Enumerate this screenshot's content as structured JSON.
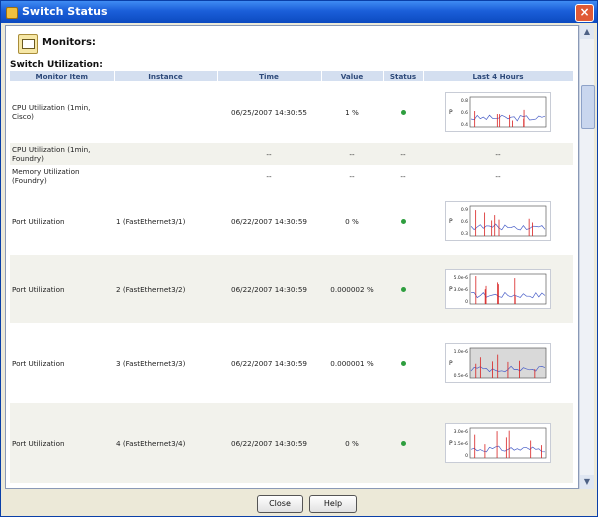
{
  "window": {
    "title": "Switch Status",
    "close_glyph": "×"
  },
  "monitors_label": "Monitors:",
  "section_title": "Switch Utilization:",
  "columns": [
    "Monitor Item",
    "Instance",
    "Time",
    "Value",
    "Status",
    "Last 4 Hours"
  ],
  "rows": [
    {
      "item": "CPU Utilization (1min, Cisco)",
      "instance": "",
      "time": "06/25/2007 14:30:55",
      "value": "1 %",
      "status": "ok",
      "chart": 0
    },
    {
      "item": "CPU Utilization (1min, Foundry)",
      "instance": "",
      "time": "--",
      "value": "--",
      "status_text": "--",
      "last4": "--"
    },
    {
      "item": "Memory Utilization (Foundry)",
      "instance": "",
      "time": "--",
      "value": "--",
      "status_text": "--",
      "last4": "--"
    },
    {
      "item": "Port Utilization",
      "instance": "1 (FastEthernet3/1)",
      "time": "06/22/2007 14:30:59",
      "value": "0 %",
      "status": "ok",
      "chart": 1
    },
    {
      "item": "Port Utilization",
      "instance": "2 (FastEthernet3/2)",
      "time": "06/22/2007 14:30:59",
      "value": "0.000002 %",
      "status": "ok",
      "chart": 2
    },
    {
      "item": "Port Utilization",
      "instance": "3 (FastEthernet3/3)",
      "time": "06/22/2007 14:30:59",
      "value": "0.000001 %",
      "status": "ok",
      "chart": 3
    },
    {
      "item": "Port Utilization",
      "instance": "4 (FastEthernet3/4)",
      "time": "06/22/2007 14:30:59",
      "value": "0 %",
      "status": "ok",
      "chart": 4
    }
  ],
  "sparklines": [
    {
      "ylabel": "P",
      "yticks": [
        "0.8",
        "0.6",
        "0.4"
      ],
      "shaded": false
    },
    {
      "ylabel": "P",
      "yticks": [
        "0.9",
        "0.6",
        "0.3"
      ],
      "shaded": false
    },
    {
      "ylabel": "P",
      "yticks": [
        "5.0e-6",
        "3.0e-6",
        "0"
      ],
      "shaded": false
    },
    {
      "ylabel": "P",
      "yticks": [
        "1.0e-6",
        "0.5e-6"
      ],
      "shaded": true
    },
    {
      "ylabel": "P",
      "yticks": [
        "3.0e-6",
        "1.5e-6",
        "0"
      ],
      "shaded": false
    }
  ],
  "buttons": {
    "close": "Close",
    "help": "Help"
  },
  "colors": {
    "titlebar": "#1b5fd9",
    "header_bg": "#d4dff0",
    "status_ok": "#2e9e3e",
    "spark_red": "#d82020",
    "spark_blue": "#4a5fc8"
  }
}
